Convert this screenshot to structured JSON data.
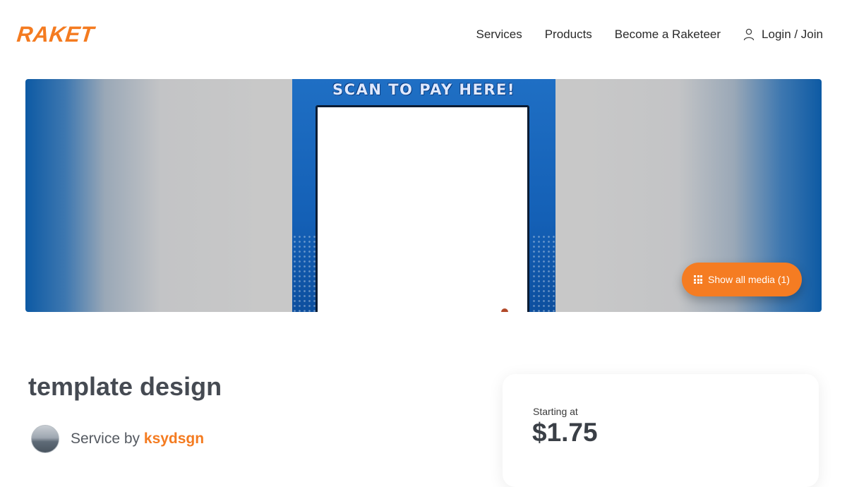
{
  "header": {
    "logo": "RAKET",
    "nav": {
      "services": "Services",
      "products": "Products",
      "become": "Become a Raketeer",
      "login": "Login / Join"
    }
  },
  "hero": {
    "poster_title": "SCAN TO PAY HERE!",
    "media_button": "Show all media (1)"
  },
  "listing": {
    "title": "template design",
    "service_prefix": "Service by",
    "seller": "ksydsgn"
  },
  "pricing": {
    "label": "Starting at",
    "price": "$1.75"
  },
  "colors": {
    "accent": "#f47b20",
    "poster_blue": "#1460b6"
  }
}
